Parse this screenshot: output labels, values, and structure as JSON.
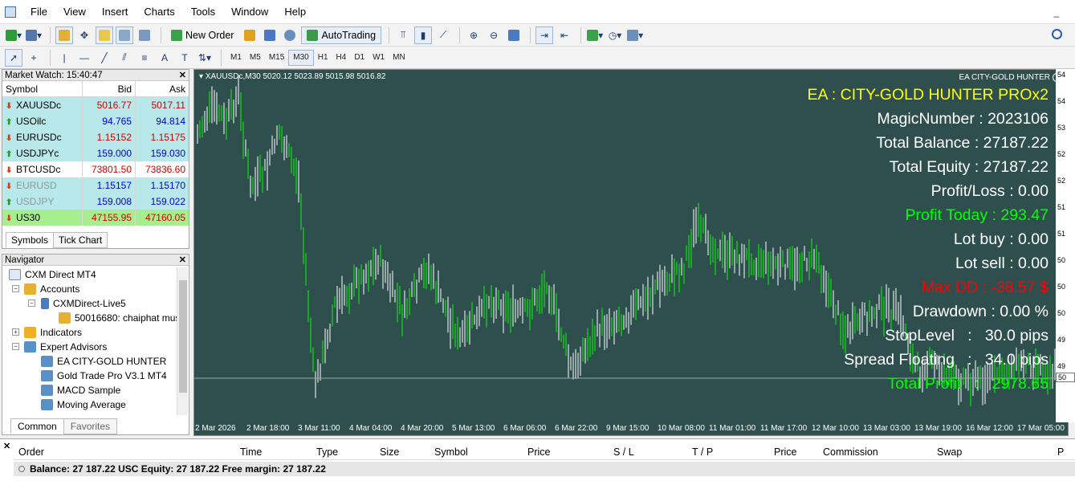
{
  "menu": [
    "File",
    "View",
    "Insert",
    "Charts",
    "Tools",
    "Window",
    "Help"
  ],
  "window_controls": "_",
  "toolbar": {
    "new_order": "New Order",
    "autotrading": "AutoTrading"
  },
  "timeframes": [
    "M1",
    "M5",
    "M15",
    "M30",
    "H1",
    "H4",
    "D1",
    "W1",
    "MN"
  ],
  "active_timeframe": "M30",
  "market_watch": {
    "title": "Market Watch: 15:40:47",
    "headers": {
      "symbol": "Symbol",
      "bid": "Bid",
      "ask": "Ask"
    },
    "rows": [
      {
        "symbol": "XAUUSDc",
        "bid": "5016.77",
        "ask": "5017.11",
        "dir": "down",
        "bg": "#b8e8ea",
        "color": "#d10000"
      },
      {
        "symbol": "USOilc",
        "bid": "94.765",
        "ask": "94.814",
        "dir": "up",
        "bg": "#b8e8ea",
        "color": "#0000d8"
      },
      {
        "symbol": "EURUSDc",
        "bid": "1.15152",
        "ask": "1.15175",
        "dir": "down",
        "bg": "#b8e8ea",
        "color": "#d10000"
      },
      {
        "symbol": "USDJPYc",
        "bid": "159.000",
        "ask": "159.030",
        "dir": "up",
        "bg": "#b8e8ea",
        "color": "#0000d8"
      },
      {
        "symbol": "BTCUSDc",
        "bid": "73801.50",
        "ask": "73836.60",
        "dir": "down",
        "bg": "#ffffff",
        "color": "#d10000"
      },
      {
        "symbol": "EURUSD",
        "bid": "1.15157",
        "ask": "1.15170",
        "dir": "down",
        "bg": "#b8e8ea",
        "color": "#0000d8",
        "dim": true
      },
      {
        "symbol": "USDJPY",
        "bid": "159.008",
        "ask": "159.022",
        "dir": "up",
        "bg": "#b8e8ea",
        "color": "#0000d8",
        "dim": true
      },
      {
        "symbol": "US30",
        "bid": "47155.95",
        "ask": "47160.05",
        "dir": "down",
        "bg": "#a6ee8e",
        "color": "#d10000"
      }
    ],
    "tabs": [
      "Symbols",
      "Tick Chart"
    ]
  },
  "navigator": {
    "title": "Navigator",
    "root": "CXM Direct MT4",
    "accounts": "Accounts",
    "server": "CXMDirect-Live5",
    "account": "50016680: chaiphat mus",
    "indicators": "Indicators",
    "experts": "Expert Advisors",
    "ea_list": [
      "EA CITY-GOLD HUNTER",
      "Gold Trade Pro V3.1 MT4",
      "MACD Sample",
      "Moving Average"
    ],
    "tabs": [
      "Common",
      "Favorites"
    ]
  },
  "chart": {
    "header": "XAUUSDc,M30  5020.12 5023.89 5015.98 5016.82",
    "ea_name": "EA CITY-GOLD HUNTER",
    "info_lines": [
      {
        "text": "EA : CITY-GOLD HUNTER PROx2",
        "color": "#ffff00"
      },
      {
        "text": "MagicNumber : 2023106",
        "color": "#ffffff"
      },
      {
        "text": "Total Balance : 27187.22",
        "color": "#ffffff"
      },
      {
        "text": "Total Equity : 27187.22",
        "color": "#ffffff"
      },
      {
        "text": "Profit/Loss : 0.00",
        "color": "#ffffff"
      },
      {
        "text": "Profit Today : 293.47",
        "color": "#00ff00"
      },
      {
        "text": "Lot buy : 0.00",
        "color": "#ffffff"
      },
      {
        "text": "Lot sell : 0.00",
        "color": "#ffffff"
      },
      {
        "text": "Max DD : -38.57 $",
        "color": "#ff0000"
      },
      {
        "text": "Drawdown : 0.00 %",
        "color": "#ffffff"
      },
      {
        "text": "StopLevel   :   30.0 pips",
        "color": "#ffffff"
      },
      {
        "text": "Spread Floating   :   34.0 pips",
        "color": "#ffffff"
      },
      {
        "text": "Total Profit   :   2978.65",
        "color": "#00ff00"
      }
    ],
    "time_labels": [
      "2 Mar 2026",
      "2 Mar 18:00",
      "3 Mar 11:00",
      "4 Mar 04:00",
      "4 Mar 20:00",
      "5 Mar 13:00",
      "6 Mar 06:00",
      "6 Mar 22:00",
      "9 Mar 15:00",
      "10 Mar 08:00",
      "11 Mar 01:00",
      "11 Mar 17:00",
      "12 Mar 10:00",
      "13 Mar 03:00",
      "13 Mar 19:00",
      "16 Mar 12:00",
      "17 Mar 05:00"
    ],
    "price_labels": [
      "54",
      "54",
      "53",
      "52",
      "52",
      "51",
      "51",
      "50",
      "50",
      "50",
      "49",
      "49"
    ],
    "current_price": "50"
  },
  "terminal": {
    "headers": [
      "Order",
      "Time",
      "Type",
      "Size",
      "Symbol",
      "Price",
      "S / L",
      "T / P",
      "Price",
      "Commission",
      "Swap",
      "P"
    ],
    "balance_line": "Balance: 27 187.22 USC  Equity: 27 187.22  Free margin: 27 187.22"
  }
}
